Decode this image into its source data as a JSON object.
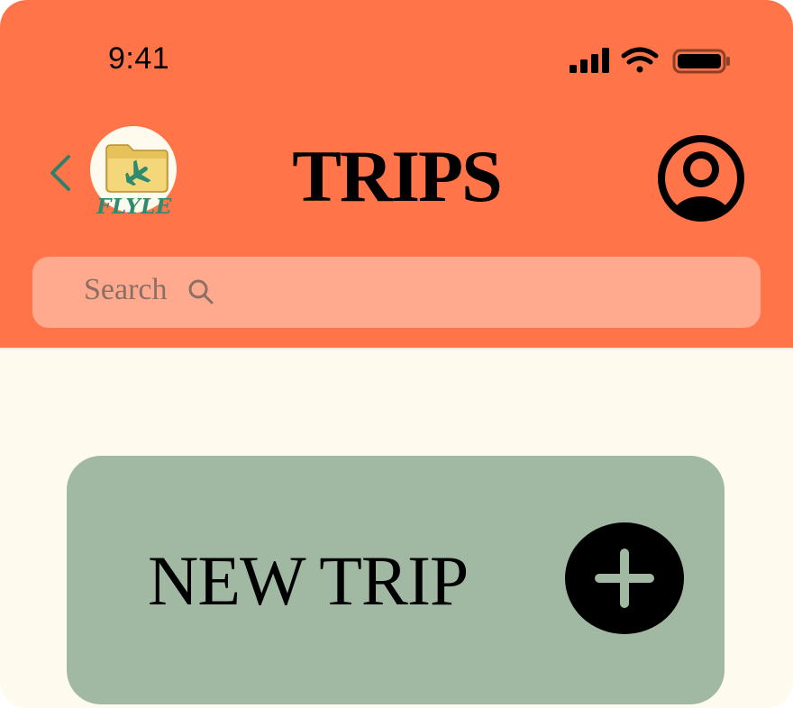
{
  "status_bar": {
    "time": "9:41",
    "icons": [
      "cellular-signal-icon",
      "wifi-icon",
      "battery-icon"
    ]
  },
  "header": {
    "back_icon": "chevron-left-icon",
    "logo_text": "FLYLE",
    "title": "TRIPS",
    "profile_icon": "user-avatar-icon"
  },
  "search": {
    "placeholder": "Search",
    "icon": "search-icon"
  },
  "new_trip": {
    "label": "NEW TRIP",
    "icon": "plus-icon"
  },
  "colors": {
    "header_bg": "#ff7549",
    "page_bg": "#fefaed",
    "search_bg": "#ffa98f",
    "card_bg": "#a1b8a2",
    "accent_teal": "#2f8b6e"
  }
}
